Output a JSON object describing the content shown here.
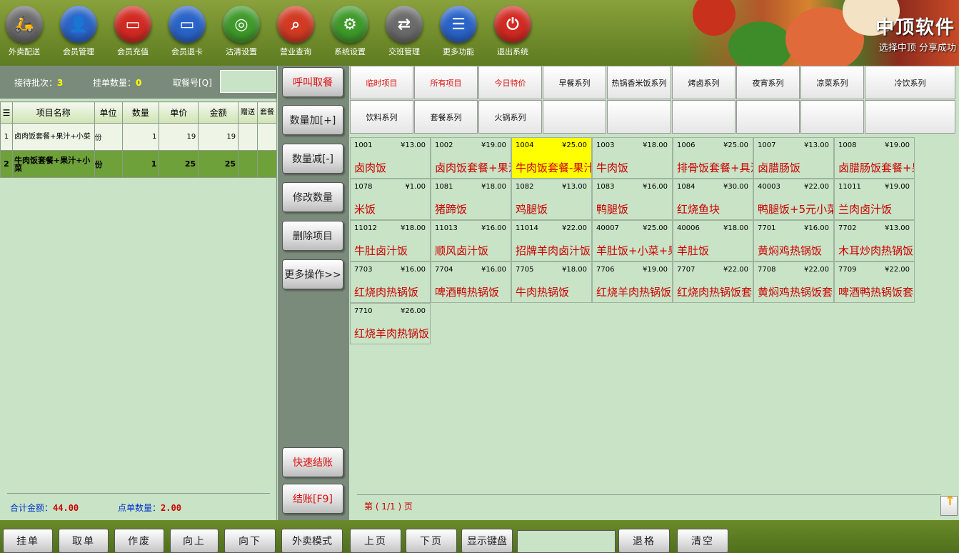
{
  "toolbar": {
    "items": [
      {
        "label": "外卖配送",
        "icon": "scooter-icon",
        "color": "#6b6b6b"
      },
      {
        "label": "会员管理",
        "icon": "member-icon",
        "color": "#2a64c8"
      },
      {
        "label": "会员充值",
        "icon": "recharge-card-icon",
        "color": "#d22a22"
      },
      {
        "label": "会员退卡",
        "icon": "refund-card-icon",
        "color": "#2a64c8"
      },
      {
        "label": "沽清设置",
        "icon": "plate-icon",
        "color": "#3f9a2a"
      },
      {
        "label": "营业查询",
        "icon": "search-icon",
        "color": "#d23a22"
      },
      {
        "label": "系统设置",
        "icon": "gear-icon",
        "color": "#3f9a2a"
      },
      {
        "label": "交班管理",
        "icon": "handover-icon",
        "color": "#6b6b6b"
      },
      {
        "label": "更多功能",
        "icon": "list-icon",
        "color": "#2a64c8"
      },
      {
        "label": "退出系统",
        "icon": "power-icon",
        "color": "#d22a22"
      }
    ]
  },
  "brand": {
    "title": "中顶软件",
    "slogan": "选择中顶 分享成功"
  },
  "stats": {
    "pending_label": "接待批次：",
    "pending_value": "3",
    "hold_label": "挂单数量：",
    "hold_value": "0",
    "pickno_label": "取餐号[Q]"
  },
  "order_table": {
    "headers": {
      "menu": "☰",
      "name": "项目名称",
      "unit": "单位",
      "qty": "数量",
      "price": "单价",
      "amount": "金额",
      "gift": "赠送",
      "set": "套餐"
    },
    "rows": [
      {
        "index": "1",
        "name": "卤肉饭套餐+果汁+小菜",
        "unit": "份",
        "qty": "1",
        "price": "19",
        "amount": "19"
      },
      {
        "index": "2",
        "name": "牛肉饭套餐+果汁+小菜",
        "unit": "份",
        "qty": "1",
        "price": "25",
        "amount": "25"
      }
    ]
  },
  "summary": {
    "total_label": "合计金额：",
    "total_value": "44.00",
    "count_label": "点单数量：",
    "count_value": "2.00"
  },
  "actions": {
    "call": "呼叫取餐",
    "qty_add": "数量加[+]",
    "qty_sub": "数量减[-]",
    "modify_qty": "修改数量",
    "delete_item": "删除项目",
    "more_ops": "更多操作>>",
    "quick_pay": "快速结账",
    "pay": "结账[F9]"
  },
  "categories": [
    {
      "label": "临时项目",
      "red": true
    },
    {
      "label": "所有项目",
      "red": true
    },
    {
      "label": "今日特价",
      "red": true
    },
    {
      "label": "早餐系列",
      "red": false
    },
    {
      "label": "热锅香米饭系列",
      "red": false
    },
    {
      "label": "烤卤系列",
      "red": false
    },
    {
      "label": "夜宵系列",
      "red": false
    },
    {
      "label": "凉菜系列",
      "red": false
    },
    {
      "label": "冷饮系列",
      "red": false
    },
    {
      "label": "饮料系列",
      "red": false
    },
    {
      "label": "套餐系列",
      "red": false
    },
    {
      "label": "火锅系列",
      "red": false
    },
    {
      "label": "",
      "red": false
    },
    {
      "label": "",
      "red": false
    },
    {
      "label": "",
      "red": false
    },
    {
      "label": "",
      "red": false
    },
    {
      "label": "",
      "red": false
    },
    {
      "label": "",
      "red": false
    }
  ],
  "items": [
    {
      "code": "1001",
      "price": "¥13.00",
      "name": "卤肉饭",
      "selected": false
    },
    {
      "code": "1002",
      "price": "¥19.00",
      "name": "卤肉饭套餐+果汁",
      "selected": false
    },
    {
      "code": "1004",
      "price": "¥25.00",
      "name": "牛肉饭套餐-果汁",
      "selected": true
    },
    {
      "code": "1003",
      "price": "¥18.00",
      "name": "牛肉饭",
      "selected": false
    },
    {
      "code": "1006",
      "price": "¥25.00",
      "name": "排骨饭套餐+具汁",
      "selected": false
    },
    {
      "code": "1007",
      "price": "¥13.00",
      "name": "卤腊肠饭",
      "selected": false
    },
    {
      "code": "1008",
      "price": "¥19.00",
      "name": "卤腊肠饭套餐+果",
      "selected": false
    },
    {
      "code": "1078",
      "price": "¥1.00",
      "name": "米饭",
      "selected": false
    },
    {
      "code": "1081",
      "price": "¥18.00",
      "name": "猪蹄饭",
      "selected": false
    },
    {
      "code": "1082",
      "price": "¥13.00",
      "name": "鸡腿饭",
      "selected": false
    },
    {
      "code": "1083",
      "price": "¥16.00",
      "name": "鸭腿饭",
      "selected": false
    },
    {
      "code": "1084",
      "price": "¥30.00",
      "name": "红烧鱼块",
      "selected": false
    },
    {
      "code": "40003",
      "price": "¥22.00",
      "name": "鸭腿饭+5元小菜",
      "selected": false
    },
    {
      "code": "11011",
      "price": "¥19.00",
      "name": "兰肉卤汁饭",
      "selected": false
    },
    {
      "code": "11012",
      "price": "¥18.00",
      "name": "牛肚卤汁饭",
      "selected": false
    },
    {
      "code": "11013",
      "price": "¥16.00",
      "name": "顺风卤汁饭",
      "selected": false
    },
    {
      "code": "11014",
      "price": "¥22.00",
      "name": "招牌羊肉卤汁饭",
      "selected": false
    },
    {
      "code": "40007",
      "price": "¥25.00",
      "name": "羊肚饭+小菜+果",
      "selected": false
    },
    {
      "code": "40006",
      "price": "¥18.00",
      "name": "羊肚饭",
      "selected": false
    },
    {
      "code": "7701",
      "price": "¥16.00",
      "name": "黄焖鸡热锅饭",
      "selected": false
    },
    {
      "code": "7702",
      "price": "¥13.00",
      "name": "木耳炒肉热锅饭",
      "selected": false
    },
    {
      "code": "7703",
      "price": "¥16.00",
      "name": "红烧肉热锅饭",
      "selected": false
    },
    {
      "code": "7704",
      "price": "¥16.00",
      "name": "啤酒鸭热锅饭",
      "selected": false
    },
    {
      "code": "7705",
      "price": "¥18.00",
      "name": "牛肉热锅饭",
      "selected": false
    },
    {
      "code": "7706",
      "price": "¥19.00",
      "name": "红烧羊肉热锅饭",
      "selected": false
    },
    {
      "code": "7707",
      "price": "¥22.00",
      "name": "红烧肉热锅饭套",
      "selected": false
    },
    {
      "code": "7708",
      "price": "¥22.00",
      "name": "黄焖鸡热锅饭套",
      "selected": false
    },
    {
      "code": "7709",
      "price": "¥22.00",
      "name": "啤酒鸭热锅饭套",
      "selected": false
    },
    {
      "code": "7710",
      "price": "¥26.00",
      "name": "红烧羊肉热锅饭",
      "selected": false
    }
  ],
  "pager": {
    "text": "第 ( 1/1 ) 页"
  },
  "bottom": {
    "hold": "挂单",
    "take": "取单",
    "void": "作废",
    "up": "向上",
    "down": "向下",
    "takeaway": "外卖模式",
    "prev": "上页",
    "next": "下页",
    "keyboard": "显示键盘",
    "back": "退格",
    "clear": "清空"
  }
}
